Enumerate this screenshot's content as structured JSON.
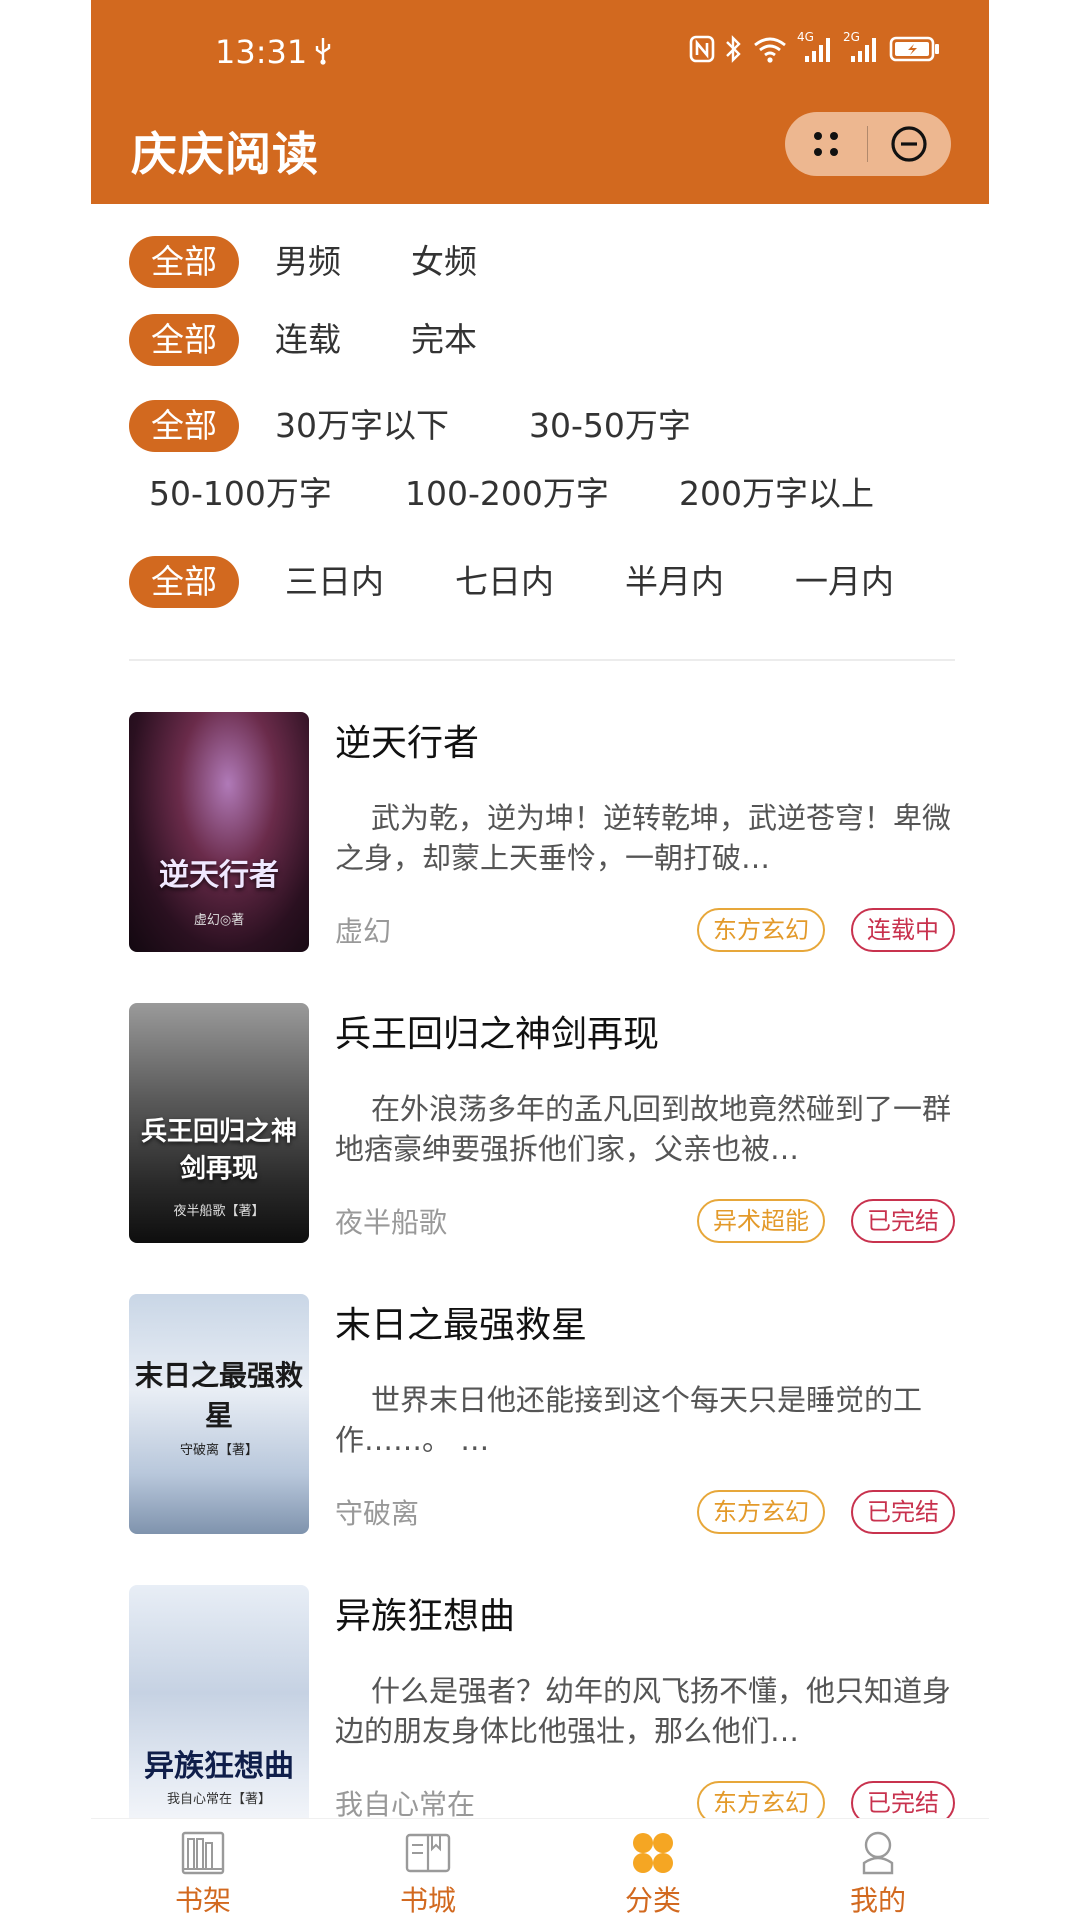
{
  "status_bar": {
    "time": "13:31",
    "net1": "4G",
    "net2": "2G"
  },
  "app": {
    "title": "庆庆阅读"
  },
  "filters": {
    "channel": {
      "active": "全部",
      "options": [
        "男频",
        "女频"
      ]
    },
    "status": {
      "active": "全部",
      "options": [
        "连载",
        "完本"
      ]
    },
    "words": {
      "active": "全部",
      "options": [
        "30万字以下",
        "30-50万字",
        "50-100万字",
        "100-200万字",
        "200万字以上"
      ]
    },
    "updated": {
      "active": "全部",
      "options": [
        "三日内",
        "七日内",
        "半月内",
        "一月内"
      ]
    }
  },
  "books": [
    {
      "title": "逆天行者",
      "desc": "武为乾，逆为坤！逆转乾坤，武逆苍穹！卑微之身，却蒙上天垂怜，一朝打破…",
      "author": "虚幻",
      "genre": "东方玄幻",
      "status": "连载中",
      "cover_title": "逆天行者",
      "cover_author": "虚幻◎著"
    },
    {
      "title": "兵王回归之神剑再现",
      "desc": "在外浪荡多年的孟凡回到故地竟然碰到了一群地痞豪绅要强拆他们家，父亲也被…",
      "author": "夜半船歌",
      "genre": "异术超能",
      "status": "已完结",
      "cover_title": "兵王回归之神剑再现",
      "cover_author": "夜半船歌【著】"
    },
    {
      "title": "末日之最强救星",
      "desc": "世界末日他还能接到这个每天只是睡觉的工作……。 …",
      "author": "守破离",
      "genre": "东方玄幻",
      "status": "已完结",
      "cover_title": "末日之最强救星",
      "cover_author": "守破离【著】"
    },
    {
      "title": "异族狂想曲",
      "desc": "什么是强者？幼年的风飞扬不懂，他只知道身边的朋友身体比他强壮，那么他们…",
      "author": "我自心常在",
      "genre": "东方玄幻",
      "status": "已完结",
      "cover_title": "异族狂想曲",
      "cover_author": "我自心常在【著】"
    }
  ],
  "tabbar": [
    {
      "label": "书架",
      "icon": "bookshelf-icon"
    },
    {
      "label": "书城",
      "icon": "book-open-icon"
    },
    {
      "label": "分类",
      "icon": "category-icon"
    },
    {
      "label": "我的",
      "icon": "user-icon"
    }
  ],
  "colors": {
    "primary": "#D2691F",
    "genre_tag": "#E39A2B",
    "status_tag": "#C8324E"
  }
}
